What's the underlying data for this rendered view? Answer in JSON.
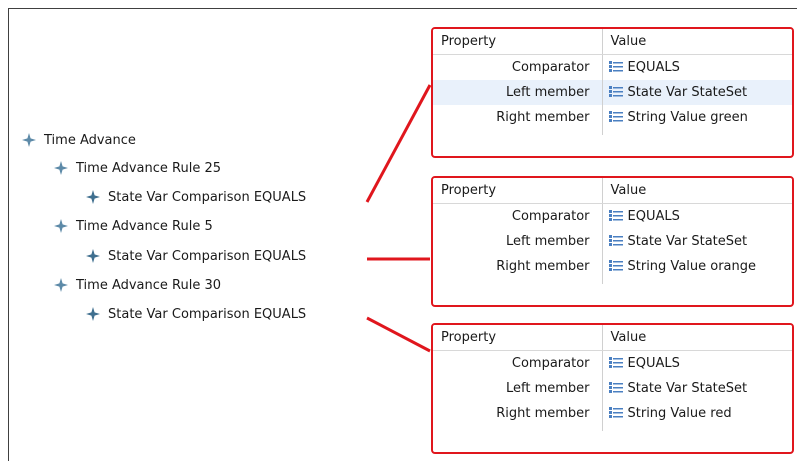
{
  "tree": {
    "root": {
      "label": "Time Advance",
      "icon": "diamond-node-icon"
    },
    "rules": [
      {
        "label": "Time Advance Rule 25",
        "child": "State Var Comparison EQUALS"
      },
      {
        "label": "Time Advance Rule 5",
        "child": "State Var Comparison EQUALS"
      },
      {
        "label": "Time Advance Rule 30",
        "child": "State Var Comparison EQUALS"
      }
    ]
  },
  "panels": [
    {
      "header": {
        "property": "Property",
        "value": "Value"
      },
      "rows": [
        {
          "property": "Comparator",
          "value": "EQUALS",
          "selected": false
        },
        {
          "property": "Left member",
          "value": "State Var StateSet",
          "selected": true
        },
        {
          "property": "Right member",
          "value": "String Value green",
          "selected": false
        }
      ]
    },
    {
      "header": {
        "property": "Property",
        "value": "Value"
      },
      "rows": [
        {
          "property": "Comparator",
          "value": "EQUALS",
          "selected": false
        },
        {
          "property": "Left member",
          "value": "State Var StateSet",
          "selected": false
        },
        {
          "property": "Right member",
          "value": "String Value orange",
          "selected": false
        }
      ]
    },
    {
      "header": {
        "property": "Property",
        "value": "Value"
      },
      "rows": [
        {
          "property": "Comparator",
          "value": "EQUALS",
          "selected": false
        },
        {
          "property": "Left member",
          "value": "State Var StateSet",
          "selected": false
        },
        {
          "property": "Right member",
          "value": "String Value red",
          "selected": false
        }
      ]
    }
  ],
  "colors": {
    "highlight": "#e0161d",
    "node_icon": "#5d8aa8",
    "selected_row": "#e9f1fb"
  }
}
